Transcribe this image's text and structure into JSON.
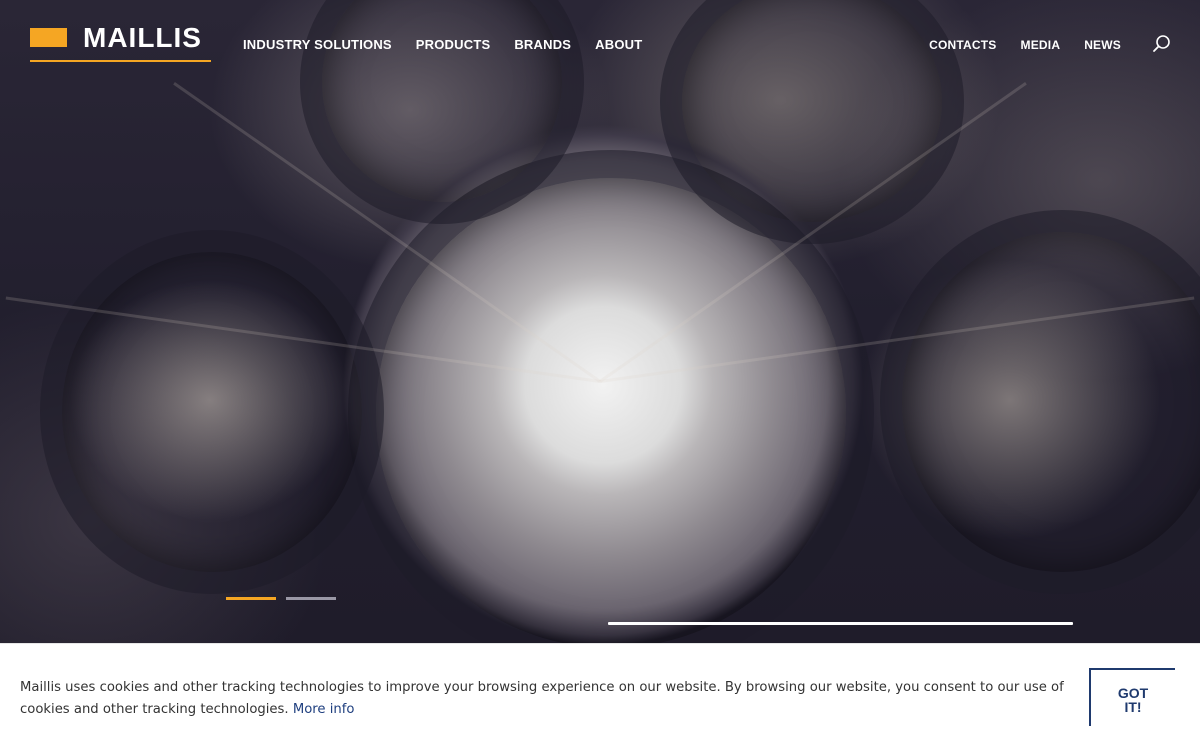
{
  "header": {
    "logo_text": "MAILLIS",
    "nav_main": [
      "INDUSTRY SOLUTIONS",
      "PRODUCTS",
      "BRANDS",
      "ABOUT"
    ],
    "nav_secondary": [
      "CONTACTS",
      "MEDIA",
      "NEWS"
    ],
    "search_icon": "search-icon"
  },
  "slider": {
    "slides": 2,
    "active_slide": 1,
    "progress": 1.0
  },
  "cookie_banner": {
    "message": "Maillis uses cookies and other tracking technologies to improve your browsing experience on our website. By browsing our website, you consent to our use of cookies and other tracking technologies.",
    "more_info_label": "More info",
    "button_label": "GOT IT!"
  },
  "colors": {
    "accent": "#f5a623",
    "navy": "#1f3a6e"
  }
}
